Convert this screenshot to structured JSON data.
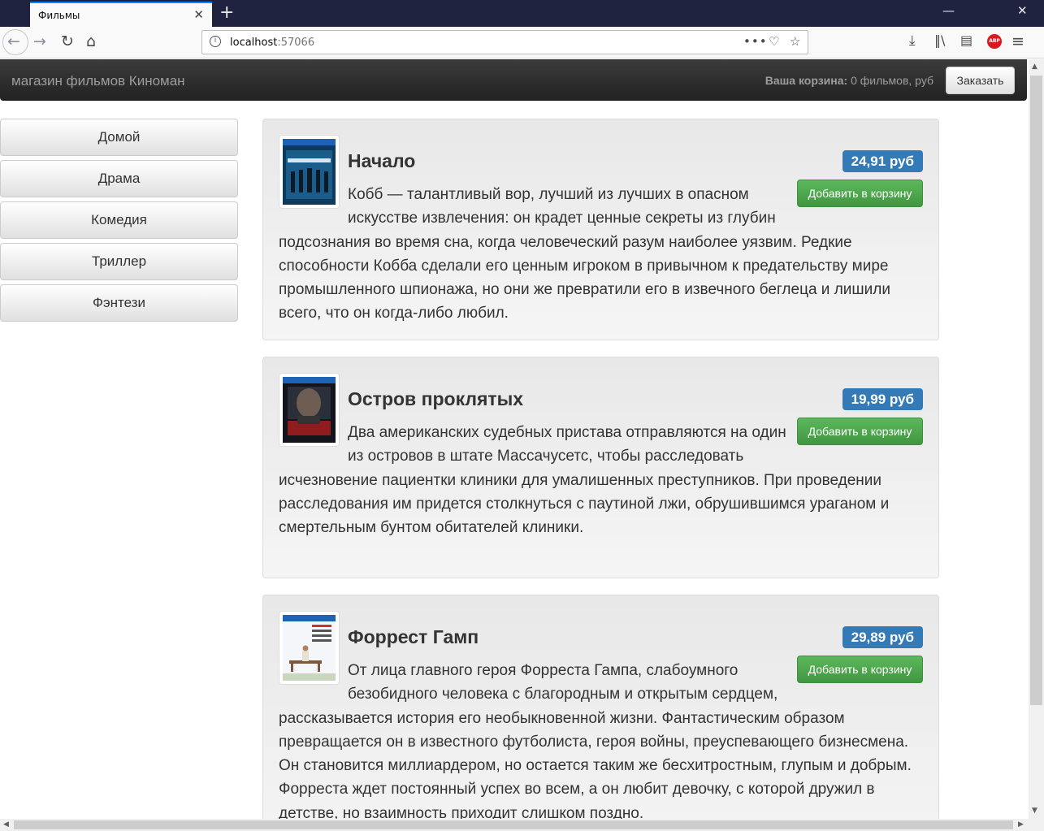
{
  "browser": {
    "tab_title": "Фильмы",
    "tab_close": "✕",
    "new_tab": "+",
    "url_host": "localhost",
    "url_port": ":57066",
    "win_min": "—",
    "win_close": "✕",
    "icons": [
      "back-arrow-icon",
      "forward-arrow-icon",
      "reload-icon",
      "home-icon",
      "site-info-icon",
      "page-actions-icon",
      "pocket-icon",
      "bookmark-star-icon",
      "download-icon",
      "library-icon",
      "sidebar-icon",
      "adblock-icon",
      "menu-icon"
    ],
    "abp_label": "ABP"
  },
  "header": {
    "brand": "магазин фильмов Киноман",
    "cart_label": "Ваша корзина:",
    "cart_summary": "0 фильмов, руб",
    "order_button": "Заказать"
  },
  "categories": [
    {
      "label": "Домой"
    },
    {
      "label": "Драма"
    },
    {
      "label": "Комедия"
    },
    {
      "label": "Триллер"
    },
    {
      "label": "Фэнтези"
    }
  ],
  "movies": [
    {
      "title": "Начало",
      "price": "24,91 руб",
      "add_button": "Добавить в корзину",
      "description": "Кобб — талантливый вор, лучший из лучших в опасном искусстве извлечения: он крадет ценные секреты из глубин подсознания во время сна, когда человеческий разум наиболее уязвим. Редкие способности Кобба сделали его ценным игроком в привычном к предательству мире промышленного шпионажа, но они же превратили его в извечного беглеца и лишили всего, что он когда-либо любил.",
      "poster_color": "#1b5d8a"
    },
    {
      "title": "Остров проклятых",
      "price": "19,99 руб",
      "add_button": "Добавить в корзину",
      "description": "Два американских судебных пристава отправляются на один из островов в штате Массачусетс, чтобы расследовать исчезновение пациентки клиники для умалишенных преступников. При проведении расследования им придется столкнуться с паутиной лжи, обрушившимся ураганом и смертельным бунтом обитателей клиники.",
      "poster_color": "#1e1e2a"
    },
    {
      "title": "Форрест Гамп",
      "price": "29,89 руб",
      "add_button": "Добавить в корзину",
      "description": "От лица главного героя Форреста Гампа, слабоумного безобидного человека с благородным и открытым сердцем, рассказывается история его необыкновенной жизни. Фантастическим образом превращается он в известного футболиста, героя войны, преуспевающего бизнесмена. Он становится миллиардером, но остается таким же бесхитростным, глупым и добрым. Форреста ждет постоянный успех во всем, а он любит девочку, с которой дружил в детстве, но взаимность приходит слишком поздно.",
      "poster_color": "#eef2f7"
    }
  ]
}
